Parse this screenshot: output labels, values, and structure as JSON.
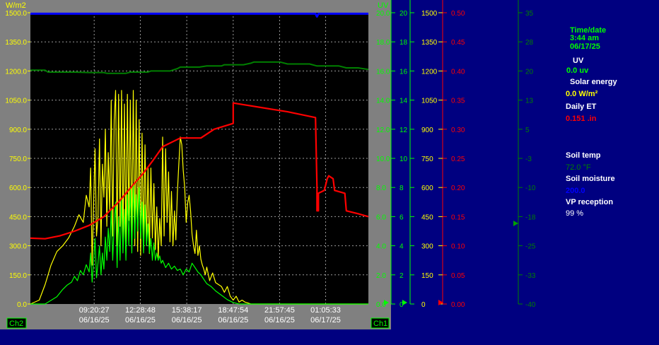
{
  "colors": {
    "background": "#000080",
    "frame": "#808080",
    "plot_bg": "#000000",
    "grid": "#9a9a9a",
    "solar": "#ffff00",
    "uv": "#00ff00",
    "et": "#ff0000",
    "soil_temp": "#008000",
    "soil_moisture": "#0000ff",
    "white": "#ffffff"
  },
  "channels": {
    "left": "Ch2",
    "right": "Ch1"
  },
  "readout": {
    "time_label": "Time/date",
    "time": "3:44 am",
    "date": "06/17/25",
    "uv_label": "UV",
    "uv_value": "0.0 uv",
    "solar_label": "Solar energy",
    "solar_value": "0.0 W/m²",
    "et_label": "Daily ET",
    "et_value": "0.151 .in",
    "soil_temp_label": "Soil temp",
    "soil_temp_value": "72.0 °F",
    "soil_moisture_label": "Soil moisture",
    "soil_moisture_value": "200.0",
    "vp_label": "VP reception",
    "vp_value": "99 %"
  },
  "chart_data": {
    "type": "line",
    "grid": true,
    "x_ticks": [
      {
        "time": "09:20:27",
        "date": "06/16/25"
      },
      {
        "time": "12:28:48",
        "date": "06/16/25"
      },
      {
        "time": "15:38:17",
        "date": "06/16/25"
      },
      {
        "time": "18:47:54",
        "date": "06/16/25"
      },
      {
        "time": "21:57:45",
        "date": "06/16/25"
      },
      {
        "time": "01:05:33",
        "date": "06/17/25"
      }
    ],
    "x_start_hour": 5.0,
    "x_end_hour": 28.0,
    "axes": [
      {
        "id": "solar",
        "unit": "W/m2",
        "ticks": [
          "1500.0",
          "1350.0",
          "1200.0",
          "1050.0",
          "900.0",
          "750.0",
          "600.0",
          "450.0",
          "300.0",
          "150.0",
          "0.0"
        ],
        "min": 0,
        "max": 1500
      },
      {
        "id": "uv",
        "unit": "UV",
        "ticks": [
          "20.0",
          "18.0",
          "16.0",
          "14.0",
          "12.0",
          "10.0",
          "8.0",
          "6.0",
          "4.0",
          "2.0",
          "0.0"
        ],
        "min": 0,
        "max": 20
      },
      {
        "id": "uv_int",
        "ticks": [
          "20",
          "18",
          "16",
          "14",
          "12",
          "10",
          "8",
          "6",
          "4",
          "2",
          "0"
        ],
        "min": 0,
        "max": 20
      },
      {
        "id": "solar_int",
        "ticks": [
          "1500",
          "1350",
          "1200",
          "1050",
          "900",
          "750",
          "600",
          "450",
          "300",
          "150",
          "0"
        ],
        "min": 0,
        "max": 1500
      },
      {
        "id": "et",
        "ticks": [
          "0.50",
          "0.45",
          "0.40",
          "0.35",
          "0.30",
          "0.25",
          "0.20",
          "0.15",
          "0.10",
          "0.05",
          "0.00"
        ],
        "min": 0,
        "max": 0.5
      },
      {
        "id": "soil_temp",
        "ticks": [
          "35",
          "28",
          "20",
          "13",
          "5",
          "-3",
          "-10",
          "-18",
          "-25",
          "-33",
          "-40"
        ],
        "min": -40,
        "max": 35
      }
    ],
    "series": [
      {
        "id": "solar",
        "axis": "solar",
        "x": [
          5.0,
          5.6,
          6.0,
          6.4,
          6.8,
          7.2,
          7.6,
          8.0,
          8.3,
          8.6,
          8.8,
          9.0,
          9.1,
          9.2,
          9.3,
          9.4,
          9.5,
          9.6,
          9.7,
          9.8,
          9.9,
          10.0,
          10.1,
          10.2,
          10.3,
          10.4,
          10.5,
          10.6,
          10.7,
          10.8,
          10.9,
          11.0,
          11.1,
          11.2,
          11.3,
          11.4,
          11.5,
          11.6,
          11.7,
          11.8,
          11.9,
          12.0,
          12.1,
          12.2,
          12.3,
          12.4,
          12.5,
          12.6,
          12.7,
          12.8,
          12.9,
          13.0,
          13.1,
          13.2,
          13.3,
          13.4,
          13.5,
          13.6,
          13.7,
          13.8,
          13.9,
          14.0,
          14.1,
          14.2,
          14.3,
          14.4,
          14.5,
          14.6,
          14.7,
          14.8,
          14.9,
          15.0,
          15.1,
          15.2,
          15.3,
          15.4,
          15.5,
          15.6,
          15.7,
          15.8,
          15.9,
          16.0,
          16.1,
          16.2,
          16.3,
          16.4,
          16.5,
          16.6,
          16.7,
          16.8,
          16.9,
          17.0,
          17.2,
          17.4,
          17.6,
          17.8,
          18.0,
          18.2,
          18.4,
          18.6,
          18.8,
          19.0,
          19.2,
          19.4,
          19.6,
          19.8,
          20.0,
          20.3,
          20.6,
          21.0,
          21.5,
          28.0
        ],
        "values": [
          0,
          20,
          100,
          200,
          270,
          300,
          340,
          400,
          460,
          420,
          560,
          500,
          700,
          200,
          520,
          800,
          350,
          450,
          850,
          300,
          720,
          550,
          900,
          400,
          780,
          480,
          1050,
          350,
          950,
          1100,
          300,
          1080,
          400,
          1100,
          330,
          1030,
          280,
          1080,
          430,
          1050,
          320,
          1100,
          300,
          1050,
          270,
          950,
          250,
          880,
          330,
          820,
          300,
          700,
          260,
          700,
          340,
          620,
          280,
          500,
          240,
          440,
          300,
          860,
          350,
          800,
          420,
          680,
          320,
          580,
          300,
          480,
          330,
          570,
          720,
          860,
          820,
          690,
          600,
          420,
          520,
          560,
          480,
          360,
          300,
          260,
          380,
          250,
          300,
          230,
          200,
          180,
          150,
          190,
          120,
          160,
          110,
          100,
          90,
          60,
          90,
          40,
          20,
          40,
          10,
          20,
          10,
          5,
          0,
          0,
          0,
          0,
          0,
          0
        ]
      },
      {
        "id": "uv",
        "axis": "uv",
        "x": [
          5.0,
          6.0,
          6.8,
          7.2,
          7.5,
          7.8,
          8.0,
          8.2,
          8.4,
          8.6,
          8.8,
          9.0,
          9.1,
          9.2,
          9.3,
          9.4,
          9.5,
          9.6,
          9.7,
          9.8,
          9.9,
          10.0,
          10.1,
          10.2,
          10.3,
          10.4,
          10.5,
          10.6,
          10.7,
          10.8,
          10.9,
          11.0,
          11.1,
          11.2,
          11.3,
          11.4,
          11.5,
          11.6,
          11.7,
          11.8,
          11.9,
          12.0,
          12.1,
          12.2,
          12.3,
          12.4,
          12.5,
          12.6,
          12.7,
          12.8,
          12.9,
          13.0,
          13.1,
          13.2,
          13.3,
          13.4,
          13.5,
          13.6,
          13.7,
          13.8,
          13.9,
          14.0,
          14.2,
          14.4,
          14.6,
          14.8,
          15.0,
          15.2,
          15.4,
          15.6,
          15.8,
          16.0,
          16.2,
          16.4,
          16.6,
          16.8,
          17.0,
          17.3,
          17.6,
          18.0,
          18.4,
          18.8,
          19.2,
          28.0
        ],
        "values": [
          0,
          0,
          0.5,
          1.0,
          1.3,
          1.5,
          1.9,
          1.6,
          2.3,
          2.0,
          2.7,
          2.2,
          3.5,
          1.5,
          3.0,
          4.5,
          1.8,
          2.8,
          4.0,
          2.0,
          3.5,
          2.4,
          4.6,
          3.0,
          5.2,
          3.6,
          6.5,
          3.0,
          5.5,
          7.0,
          2.5,
          6.0,
          3.0,
          7.2,
          3.5,
          6.5,
          3.0,
          7.5,
          4.0,
          8.0,
          3.5,
          8.2,
          4.5,
          7.5,
          5.0,
          8.0,
          4.5,
          7.0,
          3.5,
          6.8,
          4.0,
          5.5,
          3.5,
          4.5,
          3.0,
          4.2,
          3.0,
          3.5,
          3.0,
          3.3,
          2.8,
          3.0,
          2.5,
          2.8,
          2.4,
          2.6,
          2.3,
          2.4,
          2.0,
          2.4,
          2.2,
          2.8,
          2.5,
          2.2,
          2.0,
          1.7,
          1.4,
          1.2,
          0.9,
          0.6,
          0.3,
          0.1,
          0,
          0
        ]
      },
      {
        "id": "et",
        "axis": "et",
        "x": [
          5.0,
          6.0,
          7.0,
          8.0,
          9.0,
          10.0,
          11.0,
          12.0,
          12.7,
          13.3,
          14.0,
          15.2,
          15.3,
          16.6,
          16.6,
          17.5,
          17.5,
          18.8,
          18.8,
          22.5,
          24.4,
          24.5,
          24.5,
          24.6,
          24.6,
          25.0,
          25.2,
          25.3,
          25.6,
          25.7,
          26.4,
          26.5,
          27.3,
          28.0
        ],
        "values": [
          0.113,
          0.112,
          0.117,
          0.125,
          0.135,
          0.15,
          0.175,
          0.205,
          0.225,
          0.245,
          0.27,
          0.285,
          0.285,
          0.285,
          0.285,
          0.3,
          0.3,
          0.31,
          0.345,
          0.33,
          0.32,
          0.2,
          0.16,
          0.16,
          0.19,
          0.195,
          0.215,
          0.22,
          0.215,
          0.195,
          0.19,
          0.16,
          0.155,
          0.15
        ]
      },
      {
        "id": "soil_temp",
        "axis": "soil_temp",
        "x": [
          5.0,
          6.0,
          6.2,
          8.0,
          9.0,
          10.0,
          10.2,
          11.5,
          11.8,
          13.0,
          13.2,
          14.5,
          15.0,
          15.2,
          16.5,
          17.0,
          18.0,
          18.2,
          19.5,
          20.0,
          20.2,
          22.0,
          22.5,
          24.0,
          24.5,
          26.0,
          26.5,
          27.3,
          28.0
        ],
        "values": [
          20.2,
          20.2,
          19.7,
          19.7,
          19.6,
          19.6,
          19.4,
          19.4,
          19.7,
          19.7,
          20.0,
          20.0,
          20.6,
          21.0,
          21.0,
          21.3,
          21.3,
          21.6,
          21.6,
          22.0,
          22.3,
          22.3,
          21.8,
          21.8,
          21.3,
          21.3,
          20.8,
          20.8,
          20.4
        ]
      },
      {
        "id": "soil_moisture",
        "axis": "solar",
        "x": [
          5.0,
          24.4,
          24.5,
          24.6,
          28.0
        ],
        "values": [
          1495,
          1495,
          1480,
          1495,
          1495
        ]
      }
    ]
  }
}
